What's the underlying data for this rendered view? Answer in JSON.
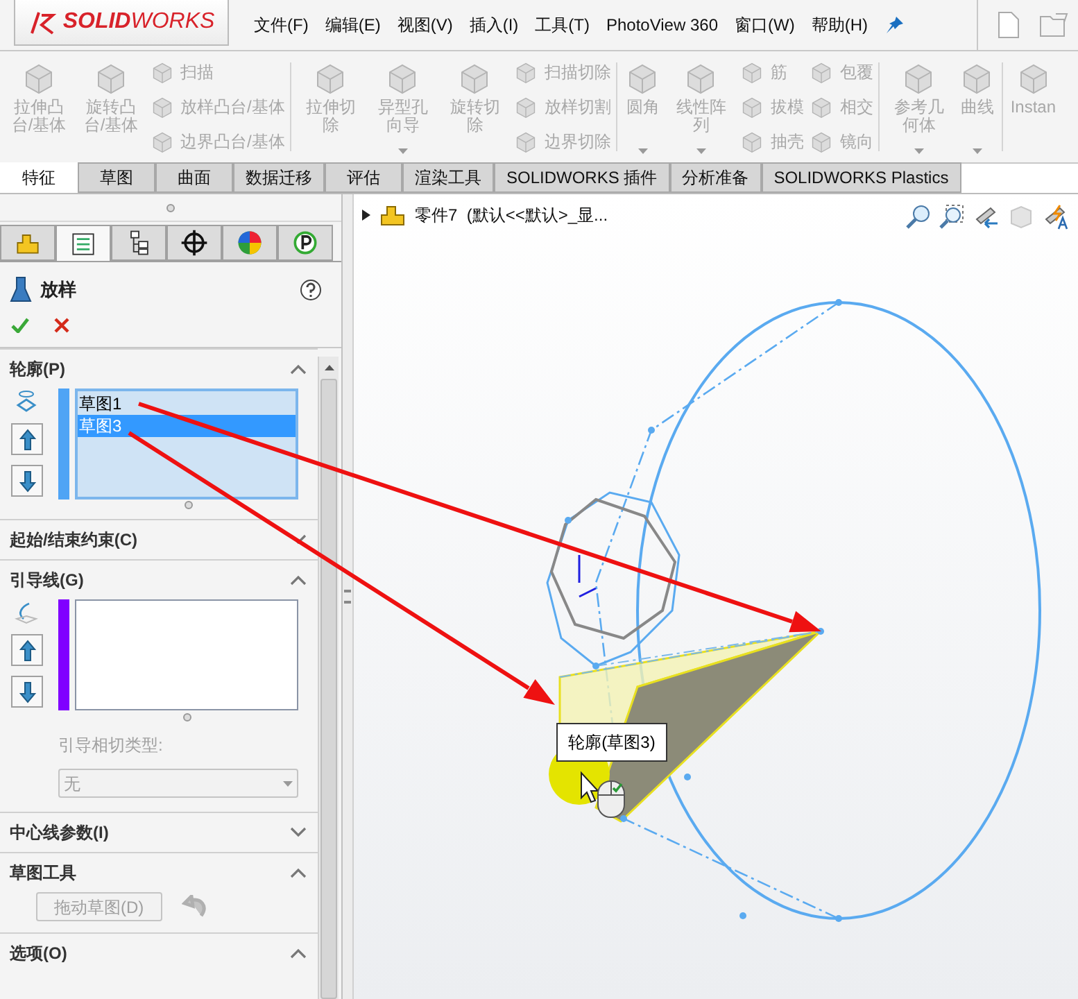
{
  "app": {
    "logo": "**SOLID**WORKS"
  },
  "menu": [
    "文件(F)",
    "编辑(E)",
    "视图(V)",
    "插入(I)",
    "工具(T)",
    "PhotoView 360",
    "窗口(W)",
    "帮助(H)"
  ],
  "ribbon": [
    {
      "kind": "large",
      "label": "拉伸凸台/基体"
    },
    {
      "kind": "large",
      "label": "旋转凸台/基体"
    },
    {
      "kind": "stack",
      "items": [
        "扫描",
        "放样凸台/基体",
        "边界凸台/基体"
      ]
    },
    {
      "kind": "separator"
    },
    {
      "kind": "large",
      "label": "拉伸切除"
    },
    {
      "kind": "large",
      "label": "异型孔向导",
      "dropdown": true
    },
    {
      "kind": "large",
      "label": "旋转切除"
    },
    {
      "kind": "stack",
      "items": [
        "扫描切除",
        "放样切割",
        "边界切除"
      ]
    },
    {
      "kind": "separator"
    },
    {
      "kind": "large",
      "label": "圆角",
      "dropdown": true
    },
    {
      "kind": "large",
      "label": "线性阵列",
      "dropdown": true
    },
    {
      "kind": "stack",
      "items": [
        "筋",
        "拔模",
        "抽壳"
      ]
    },
    {
      "kind": "stack",
      "items": [
        "包覆",
        "相交",
        "镜向"
      ]
    },
    {
      "kind": "separator"
    },
    {
      "kind": "large",
      "label": "参考几何体",
      "dropdown": true
    },
    {
      "kind": "large",
      "label": "曲线",
      "dropdown": true
    },
    {
      "kind": "separator"
    },
    {
      "kind": "large",
      "label": "Instan"
    }
  ],
  "command_tabs": [
    {
      "label": "特征",
      "selected": true
    },
    {
      "label": "草图",
      "selected": false
    },
    {
      "label": "曲面",
      "selected": false
    },
    {
      "label": "数据迁移",
      "selected": false
    },
    {
      "label": "评估",
      "selected": false
    },
    {
      "label": "渲染工具",
      "selected": false
    },
    {
      "label": "SOLIDWORKS 插件",
      "selected": false
    },
    {
      "label": "分析准备",
      "selected": false
    },
    {
      "label": "SOLIDWORKS Plastics",
      "selected": false
    }
  ],
  "panel_tabs": [
    {
      "selected": false
    },
    {
      "selected": true
    },
    {
      "selected": false
    },
    {
      "selected": false
    },
    {
      "selected": false
    },
    {
      "selected": false
    }
  ],
  "feature": {
    "title": "放样"
  },
  "sections": [
    {
      "kind": "profiles",
      "title": "轮廓(P)",
      "expanded": true,
      "items": [
        {
          "label": "草图1",
          "selected": false
        },
        {
          "label": "草图3",
          "selected": true
        }
      ]
    },
    {
      "kind": "plain",
      "title": "起始/结束约束(C)",
      "expanded": false
    },
    {
      "kind": "guides",
      "title": "引导线(G)",
      "expanded": true,
      "tangency_label": "引导相切类型:",
      "tangency_value": "无"
    },
    {
      "kind": "plain",
      "title": "中心线参数(I)",
      "expanded": false
    },
    {
      "kind": "tools",
      "title": "草图工具",
      "expanded": true,
      "button": "拖动草图(D)"
    },
    {
      "kind": "plain",
      "title": "选项(O)",
      "expanded": true
    }
  ],
  "viewport": {
    "tree_title": "零件7  (默认<<默认>_显...",
    "tooltip": "轮廓(草图3)"
  }
}
